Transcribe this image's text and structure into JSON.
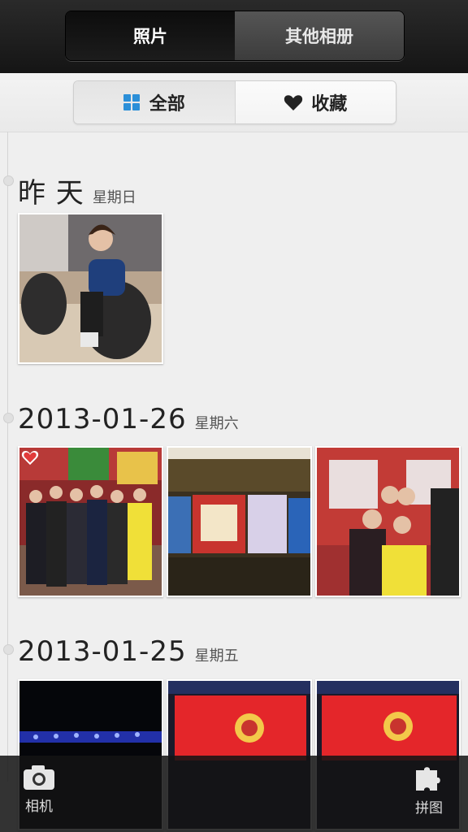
{
  "header": {
    "tabs": [
      {
        "label": "照片",
        "active": true
      },
      {
        "label": "其他相册",
        "active": false
      }
    ]
  },
  "filter": {
    "all_label": "全部",
    "favorites_label": "收藏"
  },
  "groups": [
    {
      "date": "昨 天",
      "weekday": "星期日",
      "photo_count_visible": 1
    },
    {
      "date": "2013-01-26",
      "weekday": "星期六",
      "photo_count_visible": 3
    },
    {
      "date": "2013-01-25",
      "weekday": "星期五",
      "photo_count_visible": 3
    }
  ],
  "bottom": {
    "camera_label": "相机",
    "collage_label": "拼图"
  },
  "colors": {
    "accent_blue": "#2b8fd8",
    "header_dark": "#1c1c1c",
    "favorite_red": "#e23b3b"
  }
}
